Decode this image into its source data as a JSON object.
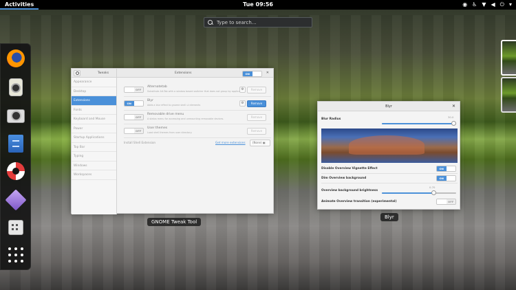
{
  "topbar": {
    "activities": "Activities",
    "clock": "Tue 09:56",
    "tray": [
      "record-icon",
      "accessibility-icon",
      "network-icon",
      "volume-icon",
      "power-icon",
      "menu-arrow-icon"
    ]
  },
  "search": {
    "placeholder": "Type to search…"
  },
  "dash": {
    "apps": [
      "Firefox",
      "Rhythmbox",
      "Cheese",
      "Files",
      "Help",
      "Gem",
      "Tweak Tool",
      "Show Applications"
    ]
  },
  "tweak_window": {
    "label": "GNOME Tweak Tool",
    "sidebar_title": "Tweaks",
    "header_title": "Extensions",
    "header_toggle": {
      "on": "ON"
    },
    "sidebar_items": [
      "Appearance",
      "Desktop",
      "Extensions",
      "Fonts",
      "Keyboard and Mouse",
      "Power",
      "Startup Applications",
      "Top Bar",
      "Typing",
      "Windows",
      "Workspaces"
    ],
    "selected_index": 2,
    "extensions": [
      {
        "toggle": "OFF",
        "name": "Alternatetab",
        "desc": "Substitute Alt-Tab with a window based switcher that does not group by application",
        "remove": "Remove",
        "active": false
      },
      {
        "toggle": "ON",
        "name": "Blyr",
        "desc": "Adds a blur effect to gnome shell ui elements",
        "remove": "Remove",
        "active": true
      },
      {
        "toggle": "OFF",
        "name": "Removable drive menu",
        "desc": "A status menu for accessing and unmounting removable devices.",
        "remove": "Remove",
        "active": false
      },
      {
        "toggle": "OFF",
        "name": "User themes",
        "desc": "Load shell themes from user directory.",
        "remove": "Remove",
        "active": false
      }
    ],
    "install_label": "Install Shell Extension",
    "more_link": "Get more extensions",
    "none_button": "(None)"
  },
  "blyr_window": {
    "title": "Blyr",
    "label": "Blyr",
    "blur_radius_label": "Blur Radius",
    "blur_radius_value": "30.0",
    "blur_radius_fraction": 0.97,
    "rows": [
      {
        "label": "Disable Overview Vignette Effect",
        "toggle": "ON"
      },
      {
        "label": "Dim Overview background",
        "toggle": "ON"
      }
    ],
    "brightness_label": "Overview background brightness",
    "brightness_value": "0.70",
    "brightness_fraction": 0.7,
    "animate_label": "Animate Overview transition (experimental)",
    "animate_toggle": "OFF"
  },
  "toggle_labels": {
    "on": "ON",
    "off": "OFF"
  }
}
